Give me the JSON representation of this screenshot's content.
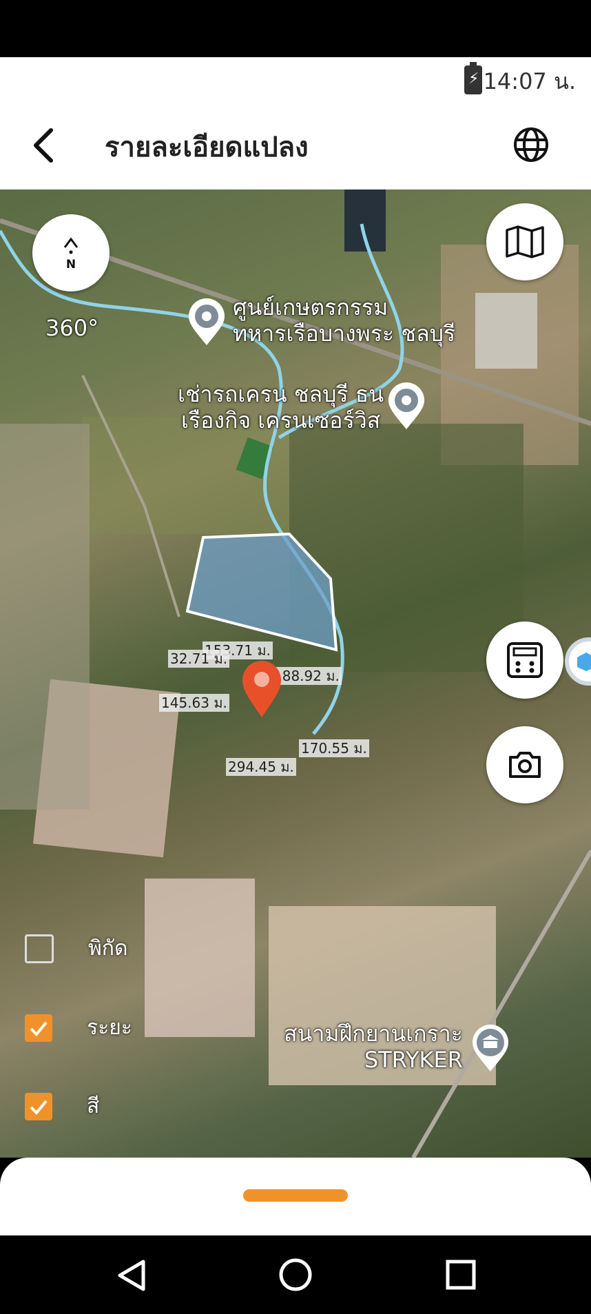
{
  "status": {
    "time": "14:07 น."
  },
  "header": {
    "title": "รายละเอียดแปลง"
  },
  "compass": {
    "label": "N",
    "degrees": "360°"
  },
  "map_labels": {
    "poi1": [
      "ศูนย์เกษตรกรรม",
      "ทหารเรือบางพระ ชลบุรี"
    ],
    "poi2": [
      "เช่ารถเครน ชลบุรี ธน",
      "เรืองกิจ เครนเซอร์วิส"
    ],
    "poi3": [
      "สนามฝึกยานเกราะ",
      "STRYKER"
    ]
  },
  "distances": [
    "153.71 ม.",
    "32.71 ม.",
    "188.92 ม.",
    "145.63 ม.",
    "170.55 ม.",
    "294.45 ม."
  ],
  "options": [
    {
      "label": "พิกัด",
      "checked": false
    },
    {
      "label": "ระยะ",
      "checked": true
    },
    {
      "label": "สี",
      "checked": true
    }
  ],
  "colors": {
    "accent": "#f0922b",
    "route": "#8fd3e8",
    "plot_fill": "#6f9fc8",
    "pin": "#e8502a"
  }
}
